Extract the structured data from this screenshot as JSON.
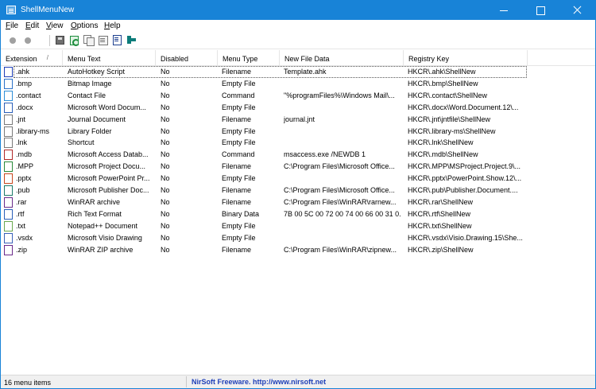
{
  "window": {
    "title": "ShellMenuNew"
  },
  "menubar": {
    "items": [
      {
        "accel": "F",
        "rest": "ile"
      },
      {
        "accel": "E",
        "rest": "dit"
      },
      {
        "accel": "V",
        "rest": "iew"
      },
      {
        "accel": "O",
        "rest": "ptions"
      },
      {
        "accel": "H",
        "rest": "elp"
      }
    ]
  },
  "toolbar": {
    "buttons": [
      "enable-item",
      "disable-item",
      "save-selected",
      "refresh",
      "copy-selected",
      "properties",
      "html-report",
      "exit"
    ]
  },
  "table": {
    "columns": [
      "Extension",
      "Menu Text",
      "Disabled",
      "Menu Type",
      "New File Data",
      "Registry Key"
    ],
    "sort_indicator": "/",
    "rows": [
      {
        "ext": ".ahk",
        "menu": "AutoHotkey Script",
        "disabled": "No",
        "type": "Filename",
        "data": "Template.ahk",
        "key": "HKCR\\.ahk\\ShellNew",
        "icon": "ahk",
        "color": "#1f3fb8"
      },
      {
        "ext": ".bmp",
        "menu": "Bitmap Image",
        "disabled": "No",
        "type": "Empty File",
        "data": "",
        "key": "HKCR\\.bmp\\ShellNew",
        "icon": "bmp",
        "color": "#2d73c9"
      },
      {
        "ext": ".contact",
        "menu": "Contact File",
        "disabled": "No",
        "type": "Command",
        "data": "\"%programFiles%\\Windows Mail\\...",
        "key": "HKCR\\.contact\\ShellNew",
        "icon": "contact",
        "color": "#2f8fd8"
      },
      {
        "ext": ".docx",
        "menu": "Microsoft Word Docum...",
        "disabled": "No",
        "type": "Empty File",
        "data": "",
        "key": "HKCR\\.docx\\Word.Document.12\\...",
        "icon": "docx",
        "color": "#2b5fb8"
      },
      {
        "ext": ".jnt",
        "menu": "Journal Document",
        "disabled": "No",
        "type": "Filename",
        "data": "journal.jnt",
        "key": "HKCR\\.jnt\\jntfile\\ShellNew",
        "icon": "jnt",
        "color": "#7a7a7a"
      },
      {
        "ext": ".library-ms",
        "menu": "Library Folder",
        "disabled": "No",
        "type": "Empty File",
        "data": "",
        "key": "HKCR\\.library-ms\\ShellNew",
        "icon": "library",
        "color": "#7a7a7a"
      },
      {
        "ext": ".lnk",
        "menu": "Shortcut",
        "disabled": "No",
        "type": "Empty File",
        "data": "",
        "key": "HKCR\\.lnk\\ShellNew",
        "icon": "lnk",
        "color": "#7a7a7a"
      },
      {
        "ext": ".mdb",
        "menu": "Microsoft Access Datab...",
        "disabled": "No",
        "type": "Command",
        "data": "msaccess.exe /NEWDB 1",
        "key": "HKCR\\.mdb\\ShellNew",
        "icon": "mdb",
        "color": "#b02a2a"
      },
      {
        "ext": ".MPP",
        "menu": "Microsoft Project Docu...",
        "disabled": "No",
        "type": "Filename",
        "data": "C:\\Program Files\\Microsoft Office...",
        "key": "HKCR\\.MPP\\MSProject.Project.9\\...",
        "icon": "mpp",
        "color": "#2a8a3a"
      },
      {
        "ext": ".pptx",
        "menu": "Microsoft PowerPoint Pr...",
        "disabled": "No",
        "type": "Empty File",
        "data": "",
        "key": "HKCR\\.pptx\\PowerPoint.Show.12\\...",
        "icon": "pptx",
        "color": "#c8471e"
      },
      {
        "ext": ".pub",
        "menu": "Microsoft Publisher Doc...",
        "disabled": "No",
        "type": "Filename",
        "data": "C:\\Program Files\\Microsoft Office...",
        "key": "HKCR\\.pub\\Publisher.Document....",
        "icon": "pub",
        "color": "#1d7a6a"
      },
      {
        "ext": ".rar",
        "menu": "WinRAR archive",
        "disabled": "No",
        "type": "Filename",
        "data": "C:\\Program Files\\WinRAR\\rarnew...",
        "key": "HKCR\\.rar\\ShellNew",
        "icon": "rar",
        "color": "#6a2a8a"
      },
      {
        "ext": ".rtf",
        "menu": "Rich Text Format",
        "disabled": "No",
        "type": "Binary Data",
        "data": "7B 00 5C 00 72 00 74 00 66 00 31 0...",
        "key": "HKCR\\.rtf\\ShellNew",
        "icon": "rtf",
        "color": "#2b5fb8"
      },
      {
        "ext": ".txt",
        "menu": "Notepad++ Document",
        "disabled": "No",
        "type": "Empty File",
        "data": "",
        "key": "HKCR\\.txt\\ShellNew",
        "icon": "txt",
        "color": "#6aa84f"
      },
      {
        "ext": ".vsdx",
        "menu": "Microsoft Visio Drawing",
        "disabled": "No",
        "type": "Empty File",
        "data": "",
        "key": "HKCR\\.vsdx\\Visio.Drawing.15\\She...",
        "icon": "vsdx",
        "color": "#3a62b8"
      },
      {
        "ext": ".zip",
        "menu": "WinRAR ZIP archive",
        "disabled": "No",
        "type": "Filename",
        "data": "C:\\Program Files\\WinRAR\\zipnew...",
        "key": "HKCR\\.zip\\ShellNew",
        "icon": "zip",
        "color": "#6a2a8a"
      }
    ]
  },
  "status": {
    "count_text": "16 menu items",
    "credit_text": "NirSoft Freeware.  http://www.nirsoft.net"
  }
}
